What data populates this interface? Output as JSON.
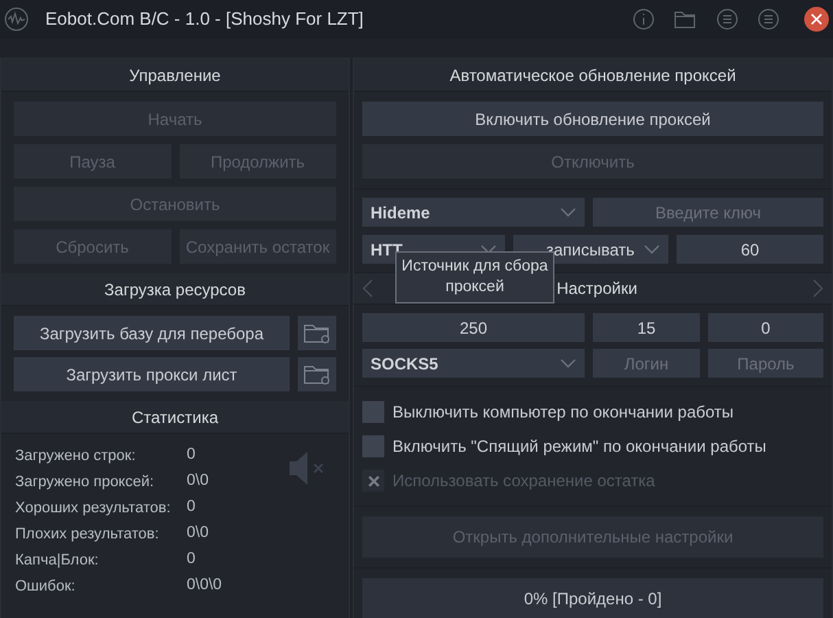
{
  "window": {
    "title": "Eobot.Com B/C - 1.0 - [Shoshy For LZT]"
  },
  "control": {
    "title": "Управление",
    "buttons": [
      {
        "label": "Начать",
        "disabled": true
      },
      {
        "label": "Пауза",
        "disabled": true
      },
      {
        "label": "Продолжить",
        "disabled": true
      },
      {
        "label": "Остановить",
        "disabled": true
      },
      {
        "label": "Сбросить",
        "disabled": true
      },
      {
        "label": "Сохранить остаток",
        "disabled": true
      }
    ]
  },
  "resources": {
    "title": "Загрузка ресурсов",
    "buttons": [
      {
        "label": "Загрузить базу для перебора"
      },
      {
        "label": "Загрузить прокси лист"
      }
    ]
  },
  "statistics": {
    "title": "Статистика",
    "muted": true,
    "rows": [
      {
        "label": "Загружено строк:",
        "value": "0"
      },
      {
        "label": "Загружено проксей:",
        "value": "0\\0"
      },
      {
        "label": "Хороших результатов:",
        "value": "0"
      },
      {
        "label": "Плохих результатов:",
        "value": "0\\0"
      },
      {
        "label": "Капча|Блок:",
        "value": "0"
      },
      {
        "label": "Ошибок:",
        "value": "0\\0\\0"
      }
    ]
  },
  "proxy_update": {
    "title": "Автоматическое обновление проксей",
    "enable_button": {
      "label": "Включить обновление проксей",
      "disabled": false
    },
    "disable_button": {
      "label": "Отключить",
      "disabled": true
    },
    "source": {
      "value": "Hideme"
    },
    "key_field": {
      "placeholder": "Введите ключ"
    },
    "protocol": {
      "value": "HTT"
    },
    "mode": {
      "value": "записывать"
    },
    "interval": {
      "value": "60"
    },
    "tooltip": "Источник для сбора проксей"
  },
  "settings": {
    "title": "Настройки",
    "threads": {
      "value": "250"
    },
    "timeout": {
      "value": "15"
    },
    "retries": {
      "value": "0"
    },
    "proxy_type": {
      "value": "SOCKS5"
    },
    "login": {
      "placeholder": "Логин"
    },
    "password": {
      "placeholder": "Пароль"
    }
  },
  "options": [
    {
      "label": "Выключить компьютер по окончании работы",
      "checked": false,
      "disabled": false
    },
    {
      "label": "Включить \"Спящий режим\" по окончании работы",
      "checked": false,
      "disabled": false
    },
    {
      "label": "Использовать сохранение остатка",
      "checked": true,
      "disabled": true
    }
  ],
  "advanced_button": {
    "label": "Открыть дополнительные настройки",
    "disabled": true
  },
  "progress": {
    "label": "0% [Пройдено - 0]",
    "level": 0
  }
}
